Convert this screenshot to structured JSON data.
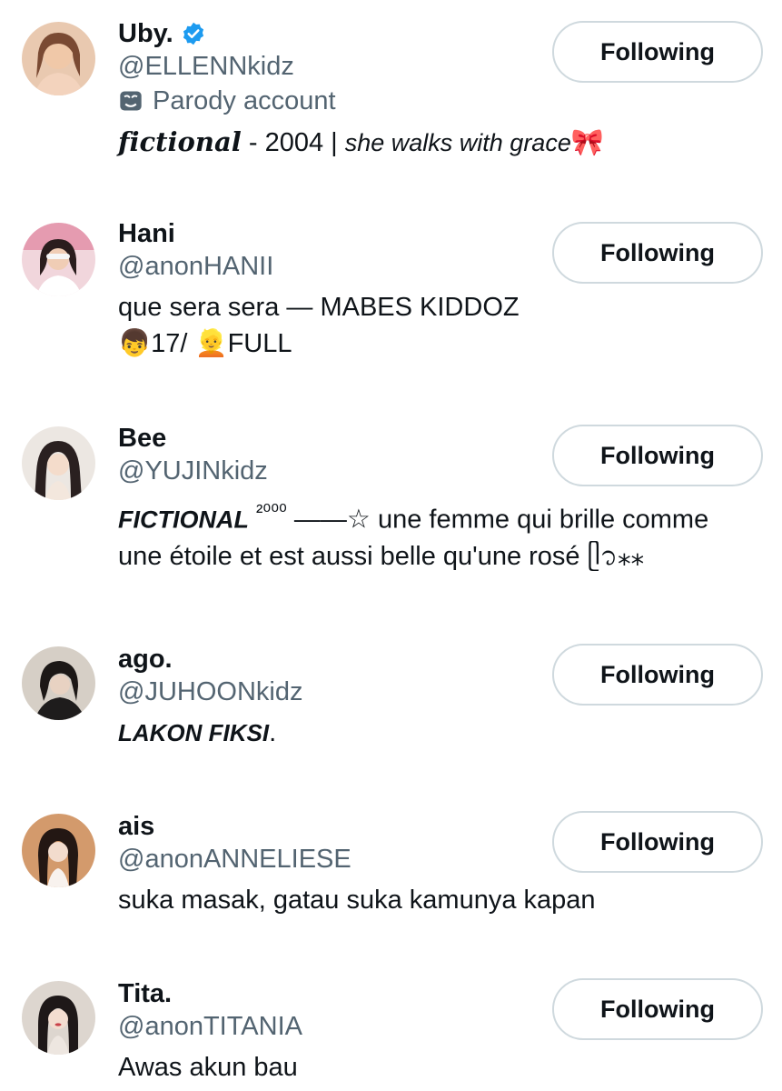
{
  "accounts": [
    {
      "name": "Uby.",
      "handle": "@ELLENNkidz",
      "parody_label": "Parody account",
      "bio": {
        "part1": "𝒇𝒊𝒄𝒕𝒊𝒐𝒏𝒂𝒍",
        "part2": " - 2004 | ",
        "part3": "she walks with grace",
        "part4": "🎀"
      },
      "button": "Following",
      "avatar_colors": [
        "#d9a98a",
        "#8a5a44"
      ]
    },
    {
      "name": "Hani",
      "handle": "@anonHANII",
      "bio": {
        "line1": "que sera sera — MABES KIDDOZ",
        "line2": "👦17/ 👱FULL"
      },
      "button": "Following",
      "avatar_colors": [
        "#e8b4b8",
        "#3b2a2a"
      ]
    },
    {
      "name": "Bee",
      "handle": "@YUJINkidz",
      "bio": {
        "part1": "FICTIONAL",
        "part2": "²⁰⁰⁰",
        "part3": " ——☆ une femme qui brille comme",
        "line2": "une étoile et est aussi belle qu'une rosé ᥫ᭡⁎⁎"
      },
      "button": "Following",
      "avatar_colors": [
        "#e9e4df",
        "#2b2220"
      ]
    },
    {
      "name": "ago.",
      "handle": "@JUHOONkidz",
      "bio": {
        "part1": "LAKON FIKSI",
        "part2": "."
      },
      "button": "Following",
      "avatar_colors": [
        "#c9c2b8",
        "#1e1a18"
      ]
    },
    {
      "name": "ais",
      "handle": "@anonANNELIESE",
      "bio": {
        "line1": "suka masak, gatau suka kamunya kapan"
      },
      "button": "Following",
      "avatar_colors": [
        "#c98a5a",
        "#2a1c16"
      ]
    },
    {
      "name": "Tita.",
      "handle": "@anonTITANIA",
      "bio": {
        "line1": "Awas akun bau"
      },
      "button": "Following",
      "avatar_colors": [
        "#d8d2cc",
        "#1f1a1a"
      ]
    }
  ]
}
